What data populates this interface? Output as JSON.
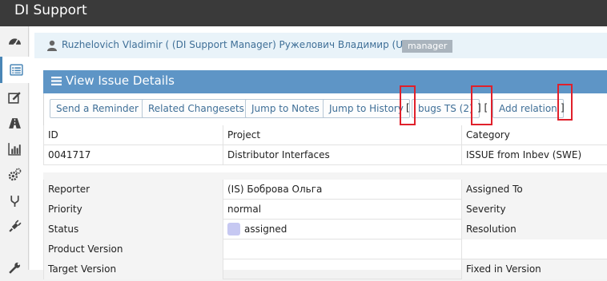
{
  "app": {
    "title": "DI Support"
  },
  "sidebar": {
    "items": [
      {
        "icon": "dashboard-icon"
      },
      {
        "icon": "list-icon",
        "active": true
      },
      {
        "icon": "edit-icon"
      },
      {
        "icon": "road-icon"
      },
      {
        "icon": "bar-chart-icon"
      },
      {
        "icon": "settings-icon"
      },
      {
        "icon": "fork-icon"
      },
      {
        "icon": "plug-icon"
      },
      {
        "icon": "wrench-icon"
      }
    ]
  },
  "user": {
    "name": "Ruzhelovich Vladimir ( (DI Support Manager) Ружелович Владимир (UTC+6) )",
    "role": "manager"
  },
  "panel": {
    "title": "View Issue Details"
  },
  "toolbar": {
    "send_reminder": "Send a Reminder",
    "related_changesets": "Related Changesets",
    "jump_to_notes": "Jump to Notes",
    "jump_to_history": "Jump to History",
    "bracket_open": "[",
    "bugs_ts": "bugs TS (2)",
    "bracket_mid": "] [",
    "add_relation": "Add relation",
    "bracket_close": "]"
  },
  "details": {
    "header": {
      "id": "ID",
      "project": "Project",
      "category": "Category"
    },
    "values": {
      "id": "0041717",
      "project": "Distributor Interfaces",
      "category": "ISSUE from Inbev (SWE)"
    },
    "reporter_label": "Reporter",
    "reporter_value": "(IS) Боброва Ольга",
    "assigned_to_label": "Assigned To",
    "priority_label": "Priority",
    "priority_value": "normal",
    "severity_label": "Severity",
    "status_label": "Status",
    "status_value": "assigned",
    "status_color": "#c6c8f2",
    "resolution_label": "Resolution",
    "product_version_label": "Product Version",
    "target_version_label": "Target Version",
    "fixed_in_version_label": "Fixed in Version"
  }
}
